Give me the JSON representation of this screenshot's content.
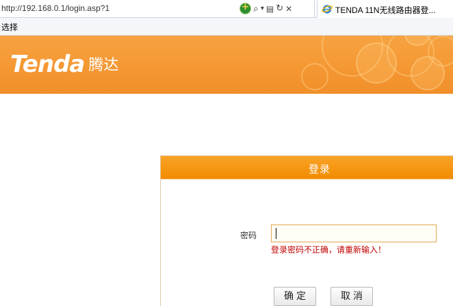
{
  "browser": {
    "url": "http://192.168.0.1/login.asp?1",
    "tab_title": "TENDA 11N无线路由器登...",
    "menu": [
      "选择"
    ],
    "icons": [
      "compatibility-icon",
      "search-icon",
      "dropdown-arrow-icon",
      "compat-view-icon",
      "refresh-icon",
      "stop-icon",
      "ie-icon"
    ],
    "search_icon_glyph": "⌕",
    "dropdown_glyph": "▾",
    "compat_view_glyph": "▤",
    "refresh_glyph": "↻",
    "stop_glyph": "✕"
  },
  "banner": {
    "brand": "Tenda",
    "brand_cn": "腾达",
    "bg_color": "#f49833"
  },
  "login": {
    "title": "登录",
    "password_label": "密码",
    "password_value": "",
    "error": "登录密码不正确，请重新输入！",
    "ok_button": "确定",
    "cancel_button": "取消",
    "header_color": "#f28c00",
    "error_color": "#c00000"
  }
}
